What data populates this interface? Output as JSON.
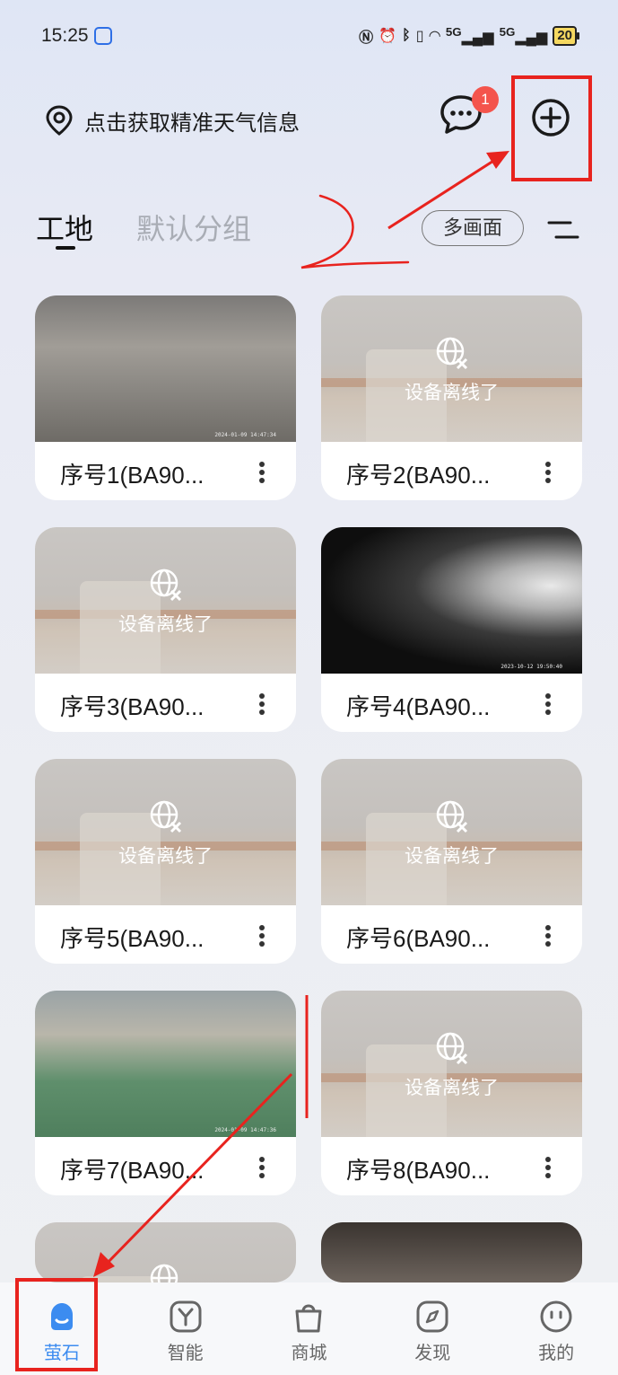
{
  "status_bar": {
    "time": "15:25",
    "network1": "5G",
    "network2": "5G",
    "battery": "20"
  },
  "header": {
    "weather_text": "点击获取精准天气信息",
    "message_badge": "1"
  },
  "tabs": {
    "active": "工地",
    "inactive": "默认分组",
    "multi_view": "多画面"
  },
  "offline_text": "设备离线了",
  "devices": [
    {
      "name": "序号1(BA90...",
      "stamp": "2024-01-09 14:47:34"
    },
    {
      "name": "序号2(BA90..."
    },
    {
      "name": "序号3(BA90..."
    },
    {
      "name": "序号4(BA90...",
      "stamp": "2023-10-12 19:50:40"
    },
    {
      "name": "序号5(BA90..."
    },
    {
      "name": "序号6(BA90..."
    },
    {
      "name": "序号7(BA90...",
      "stamp": "2024-01-09 14:47:36"
    },
    {
      "name": "序号8(BA90..."
    }
  ],
  "nav": {
    "home": "萤石",
    "smart": "智能",
    "mall": "商城",
    "discover": "发现",
    "me": "我的"
  },
  "colors": {
    "accent": "#3c8cf0",
    "badge": "#f4544c",
    "annotation": "#e8231e"
  }
}
